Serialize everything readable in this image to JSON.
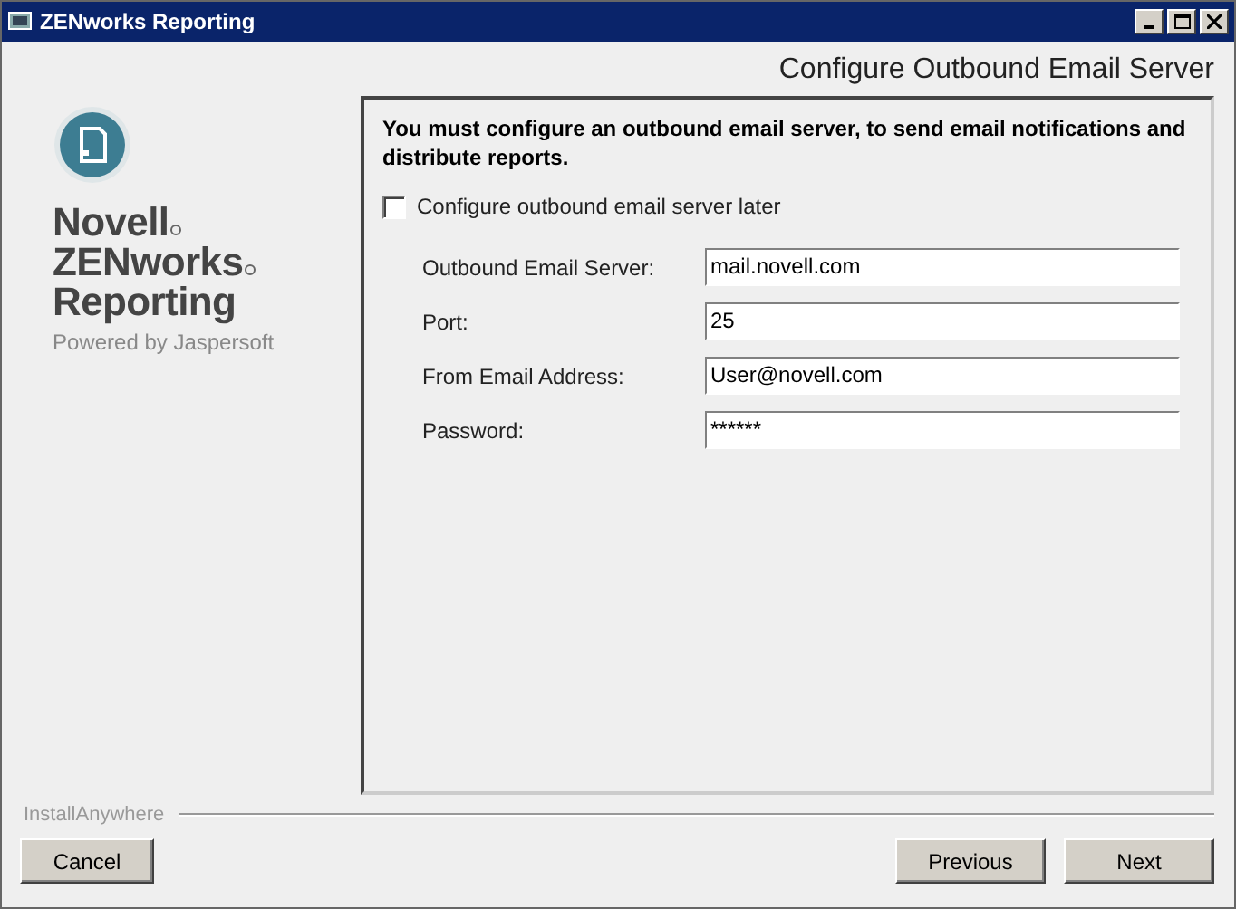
{
  "window": {
    "title": "ZENworks Reporting"
  },
  "header": {
    "title": "Configure Outbound Email Server"
  },
  "branding": {
    "lines": [
      {
        "text": "Novell",
        "registered": true
      },
      {
        "text": "ZENworks",
        "registered": true
      },
      {
        "text": "Reporting",
        "registered": false
      }
    ],
    "tagline": "Powered by Jaspersoft"
  },
  "panel": {
    "message": "You must configure an outbound email server, to send email notifications and distribute reports.",
    "later_checkbox": {
      "label": "Configure outbound email server later",
      "checked": false
    },
    "fields": [
      {
        "label": "Outbound Email Server:",
        "value": "mail.novell.com"
      },
      {
        "label": "Port:",
        "value": "25"
      },
      {
        "label": "From Email Address:",
        "value": "User@novell.com"
      },
      {
        "label": "Password:",
        "value": "******"
      }
    ]
  },
  "footer": {
    "brand": "InstallAnywhere",
    "buttons": [
      {
        "label": "Cancel",
        "kind": "cancel"
      },
      {
        "label": "Previous",
        "kind": "nav"
      },
      {
        "label": "Next",
        "kind": "nav"
      }
    ]
  }
}
